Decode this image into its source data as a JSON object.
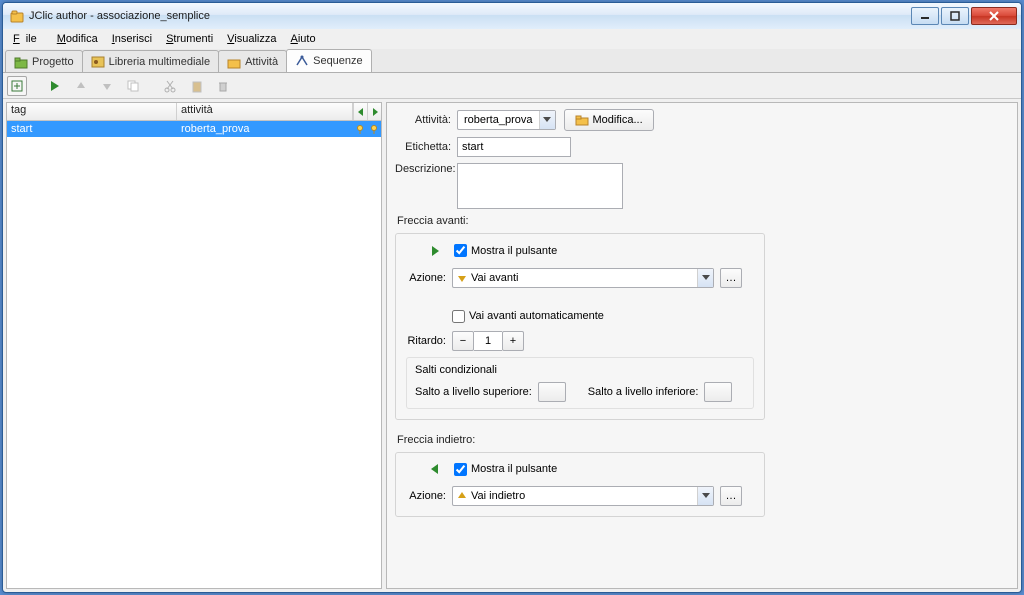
{
  "window": {
    "title": "JClic author - associazione_semplice"
  },
  "menubar": [
    "File",
    "Modifica",
    "Inserisci",
    "Strumenti",
    "Visualizza",
    "Aiuto"
  ],
  "tabs": [
    "Progetto",
    "Libreria multimediale",
    "Attività",
    "Sequenze"
  ],
  "left": {
    "cols": {
      "tag": "tag",
      "activity": "attività"
    },
    "row": {
      "tag": "start",
      "activity": "roberta_prova"
    }
  },
  "form": {
    "labels": {
      "activity": "Attività:",
      "label": "Etichetta:",
      "description": "Descrizione:"
    },
    "activity_value": "roberta_prova",
    "modify": "Modifica...",
    "label_value": "start",
    "description_value": ""
  },
  "forward": {
    "legend": "Freccia avanti:",
    "show_button": "Mostra il pulsante",
    "action_label": "Azione:",
    "action_value": "Vai avanti",
    "auto": "Vai avanti automaticamente",
    "delay_label": "Ritardo:",
    "delay_value": "1",
    "cond_header": "Salti condizionali",
    "jump_up": "Salto a livello superiore:",
    "jump_down": "Salto a livello inferiore:"
  },
  "back": {
    "legend": "Freccia indietro:",
    "show_button": "Mostra il pulsante",
    "action_label": "Azione:",
    "action_value": "Vai indietro"
  }
}
